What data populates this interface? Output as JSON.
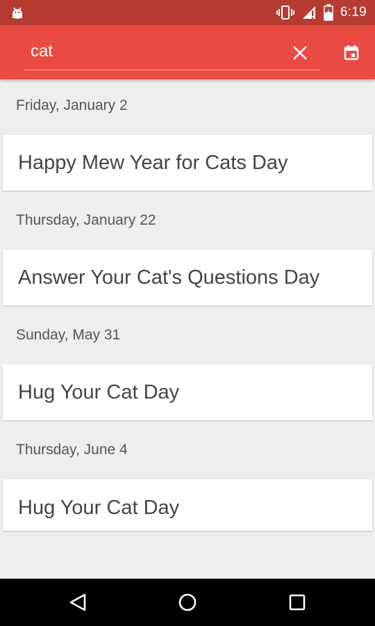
{
  "status_bar": {
    "time": "6:19",
    "icons": [
      "android-icon",
      "vibrate-icon",
      "signal-icon",
      "battery-icon"
    ]
  },
  "search": {
    "value": "cat",
    "clear_icon": "close-icon",
    "calendar_icon": "calendar-icon"
  },
  "results": [
    {
      "date": "Friday, January 2",
      "title": "Happy Mew Year for Cats Day"
    },
    {
      "date": "Thursday, January 22",
      "title": "Answer Your Cat's Questions Day"
    },
    {
      "date": "Sunday, May 31",
      "title": "Hug Your Cat Day"
    },
    {
      "date": "Thursday, June 4",
      "title": "Hug Your Cat Day"
    }
  ],
  "nav_bar": {
    "icons": [
      "back-icon",
      "home-icon",
      "recents-icon"
    ]
  },
  "colors": {
    "status_bar": "#b63c33",
    "app_bar": "#e94b43",
    "background": "#eeeeee"
  }
}
